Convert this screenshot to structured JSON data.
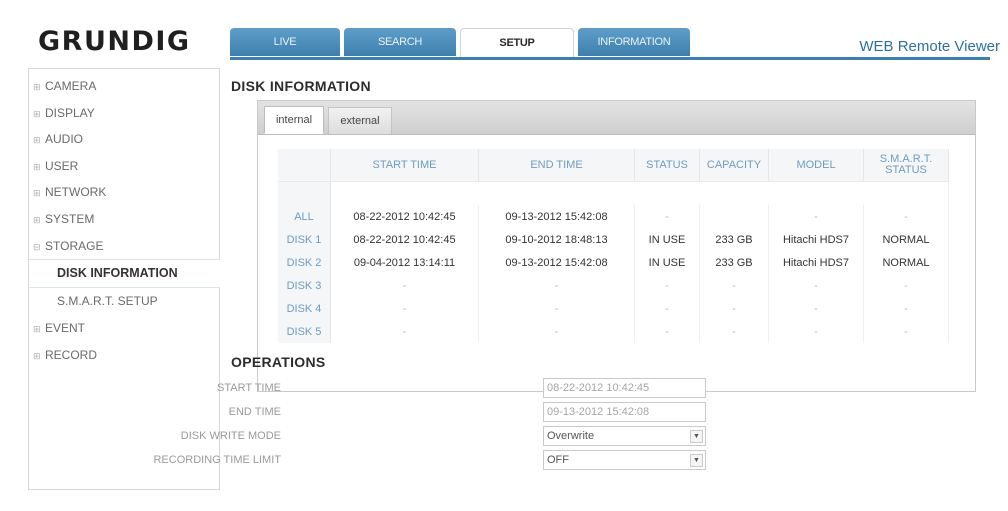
{
  "brand": {
    "logo_text": "GRUNDIG",
    "app_title": "WEB Remote Viewer"
  },
  "top_tabs": [
    {
      "label": "LIVE"
    },
    {
      "label": "SEARCH"
    },
    {
      "label": "SETUP",
      "active": true
    },
    {
      "label": "INFORMATION"
    }
  ],
  "sidebar": {
    "items": [
      {
        "label": "CAMERA"
      },
      {
        "label": "DISPLAY"
      },
      {
        "label": "AUDIO"
      },
      {
        "label": "USER"
      },
      {
        "label": "NETWORK"
      },
      {
        "label": "SYSTEM"
      },
      {
        "label": "STORAGE",
        "expanded": true
      }
    ],
    "storage_subitems": [
      {
        "label": "DISK INFORMATION",
        "active": true
      },
      {
        "label": "S.M.A.R.T. SETUP"
      }
    ],
    "items_after": [
      {
        "label": "EVENT"
      },
      {
        "label": "RECORD"
      }
    ]
  },
  "disk_info": {
    "title": "DISK INFORMATION",
    "tabs": [
      {
        "label": "internal",
        "active": true
      },
      {
        "label": "external"
      }
    ],
    "columns": [
      "START TIME",
      "END TIME",
      "STATUS",
      "CAPACITY",
      "MODEL",
      "S.M.A.R.T. STATUS"
    ],
    "rows": [
      {
        "label": "ALL",
        "cells": [
          "08-22-2012 10:42:45",
          "09-13-2012 15:42:08",
          "-",
          "",
          "-",
          "-"
        ]
      },
      {
        "label": "DISK 1",
        "cells": [
          "08-22-2012 10:42:45",
          "09-10-2012 18:48:13",
          "IN USE",
          "233 GB",
          "Hitachi HDS7",
          "NORMAL"
        ]
      },
      {
        "label": "DISK 2",
        "cells": [
          "09-04-2012 13:14:11",
          "09-13-2012 15:42:08",
          "IN USE",
          "233 GB",
          "Hitachi HDS7",
          "NORMAL"
        ]
      },
      {
        "label": "DISK 3",
        "cells": [
          "-",
          "-",
          "-",
          "-",
          "-",
          "-"
        ]
      },
      {
        "label": "DISK 4",
        "cells": [
          "-",
          "-",
          "-",
          "-",
          "-",
          "-"
        ]
      },
      {
        "label": "DISK 5",
        "cells": [
          "-",
          "-",
          "-",
          "-",
          "-",
          "-"
        ]
      }
    ]
  },
  "operations": {
    "title": "OPERATIONS",
    "fields": [
      {
        "label": "START TIME",
        "value": "08-22-2012 10:42:45",
        "type": "text"
      },
      {
        "label": "END TIME",
        "value": "09-13-2012 15:42:08",
        "type": "text"
      },
      {
        "label": "DISK WRITE MODE",
        "value": "Overwrite",
        "type": "select"
      },
      {
        "label": "RECORDING TIME LIMIT",
        "value": "OFF",
        "type": "select"
      }
    ]
  },
  "icons": {
    "expand": "plus-box-icon",
    "dropdown": "dropdown-arrow-icon"
  },
  "colors": {
    "tab_blue": "#4a8cba",
    "label_blue": "#6f9cc0",
    "title_blue": "#2f6f9f"
  }
}
